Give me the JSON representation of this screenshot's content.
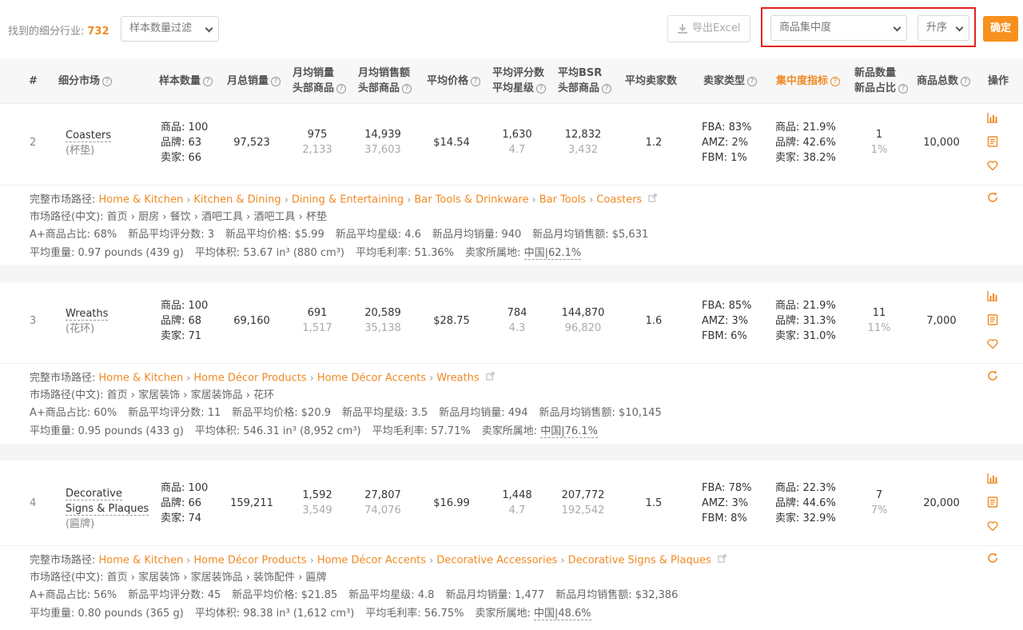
{
  "toolbar": {
    "found_label": "找到的细分行业:",
    "found_count": "732",
    "sample_filter": "样本数量过滤",
    "export_label": "导出Excel",
    "metric_select": "商品集中度",
    "order_select": "升序",
    "confirm": "确定"
  },
  "header": {
    "idx": "#",
    "market": "细分市场",
    "samples": "样本数量",
    "monthly_sales": "月总销量",
    "msales_1": "月均销量",
    "msales_2": "头部商品",
    "mrev_1": "月均销售额",
    "mrev_2": "头部商品",
    "avg_price": "平均价格",
    "rating_1": "平均评分数",
    "rating_2": "平均星级",
    "bsr_1": "平均BSR",
    "bsr_2": "头部商品",
    "sellers": "平均卖家数",
    "seller_type": "卖家类型",
    "concentration": "集中度指标",
    "new_1": "新品数量",
    "new_2": "新品占比",
    "total": "商品总数",
    "ops": "操作"
  },
  "rows": [
    {
      "idx": "2",
      "name_lines": [
        "Coasters"
      ],
      "name_cn": "(杯垫)",
      "s1": "商品: 100",
      "s2": "品牌: 63",
      "s3": "卖家: 66",
      "monthly_sales": "97,523",
      "ms_top": "975",
      "ms_sub": "2,133",
      "rev_top": "14,939",
      "rev_sub": "37,603",
      "price": "$14.54",
      "rating_top": "1,630",
      "rating_sub": "4.7",
      "bsr_top": "12,832",
      "bsr_sub": "3,432",
      "sellers": "1.2",
      "fba": "FBA: 83%",
      "amz": "AMZ: 2%",
      "fbm": "FBM: 1%",
      "c1": "商品: 21.9%",
      "c2": "品牌: 42.6%",
      "c3": "卖家: 38.2%",
      "new_top": "1",
      "new_sub": "1%",
      "total": "10,000",
      "path_label": "完整市场路径:",
      "path": [
        "Home & Kitchen",
        "Kitchen & Dining",
        "Dining & Entertaining",
        "Bar Tools & Drinkware",
        "Bar Tools",
        "Coasters"
      ],
      "path_cn": "市场路径(中文): 首页 › 厨房 › 餐饮 › 酒吧工具 › 酒吧工具 › 杯垫",
      "stats1": [
        "A+商品占比: 68%",
        "新品平均评分数: 3",
        "新品平均价格: $5.99",
        "新品平均星级: 4.6",
        "新品月均销量: 940",
        "新品月均销售额: $5,631"
      ],
      "stats2": [
        "平均重量: 0.97 pounds (439 g)",
        "平均体积: 53.67 in³ (880 cm³)",
        "平均毛利率: 51.36%"
      ],
      "origin_label": "卖家所属地:",
      "origin": "中国|62.1%"
    },
    {
      "idx": "3",
      "name_lines": [
        "Wreaths"
      ],
      "name_cn": "(花环)",
      "s1": "商品: 100",
      "s2": "品牌: 68",
      "s3": "卖家: 71",
      "monthly_sales": "69,160",
      "ms_top": "691",
      "ms_sub": "1,517",
      "rev_top": "20,589",
      "rev_sub": "35,138",
      "price": "$28.75",
      "rating_top": "784",
      "rating_sub": "4.3",
      "bsr_top": "144,870",
      "bsr_sub": "96,820",
      "sellers": "1.6",
      "fba": "FBA: 85%",
      "amz": "AMZ: 3%",
      "fbm": "FBM: 6%",
      "c1": "商品: 21.9%",
      "c2": "品牌: 31.3%",
      "c3": "卖家: 31.0%",
      "new_top": "11",
      "new_sub": "11%",
      "total": "7,000",
      "path_label": "完整市场路径:",
      "path": [
        "Home & Kitchen",
        "Home Décor Products",
        "Home Décor Accents",
        "Wreaths"
      ],
      "path_cn": "市场路径(中文): 首页 › 家居装饰 › 家居装饰品 › 花环",
      "stats1": [
        "A+商品占比: 60%",
        "新品平均评分数: 11",
        "新品平均价格: $20.9",
        "新品平均星级: 3.5",
        "新品月均销量: 494",
        "新品月均销售额: $10,145"
      ],
      "stats2": [
        "平均重量: 0.95 pounds (433 g)",
        "平均体积: 546.31 in³ (8,952 cm³)",
        "平均毛利率: 57.71%"
      ],
      "origin_label": "卖家所属地:",
      "origin": "中国|76.1%"
    },
    {
      "idx": "4",
      "name_lines": [
        "Decorative",
        "Signs & Plaques"
      ],
      "name_cn": "(匾牌)",
      "s1": "商品: 100",
      "s2": "品牌: 66",
      "s3": "卖家: 74",
      "monthly_sales": "159,211",
      "ms_top": "1,592",
      "ms_sub": "3,549",
      "rev_top": "27,807",
      "rev_sub": "74,076",
      "price": "$16.99",
      "rating_top": "1,448",
      "rating_sub": "4.7",
      "bsr_top": "207,772",
      "bsr_sub": "192,542",
      "sellers": "1.5",
      "fba": "FBA: 78%",
      "amz": "AMZ: 3%",
      "fbm": "FBM: 8%",
      "c1": "商品: 22.3%",
      "c2": "品牌: 44.6%",
      "c3": "卖家: 32.9%",
      "new_top": "7",
      "new_sub": "7%",
      "total": "20,000",
      "path_label": "完整市场路径:",
      "path": [
        "Home & Kitchen",
        "Home Décor Products",
        "Home Décor Accents",
        "Decorative Accessories",
        "Decorative Signs & Plaques"
      ],
      "path_cn": "市场路径(中文): 首页 › 家居装饰 › 家居装饰品 › 装饰配件 › 匾牌",
      "stats1": [
        "A+商品占比: 56%",
        "新品平均评分数: 45",
        "新品平均价格: $21.85",
        "新品平均星级: 4.8",
        "新品月均销量: 1,477",
        "新品月均销售额: $32,386"
      ],
      "stats2": [
        "平均重量: 0.80 pounds (365 g)",
        "平均体积: 98.38 in³ (1,612 cm³)",
        "平均毛利率: 56.75%"
      ],
      "origin_label": "卖家所属地:",
      "origin": "中国|48.6%"
    }
  ],
  "colors": {
    "accent": "#f7901e",
    "highlight_box": "#e32222"
  },
  "icons": [
    "download-icon",
    "help-icon",
    "chart-icon",
    "document-icon",
    "heart-icon",
    "refresh-icon",
    "external-link-icon",
    "chevron-down-icon"
  ]
}
